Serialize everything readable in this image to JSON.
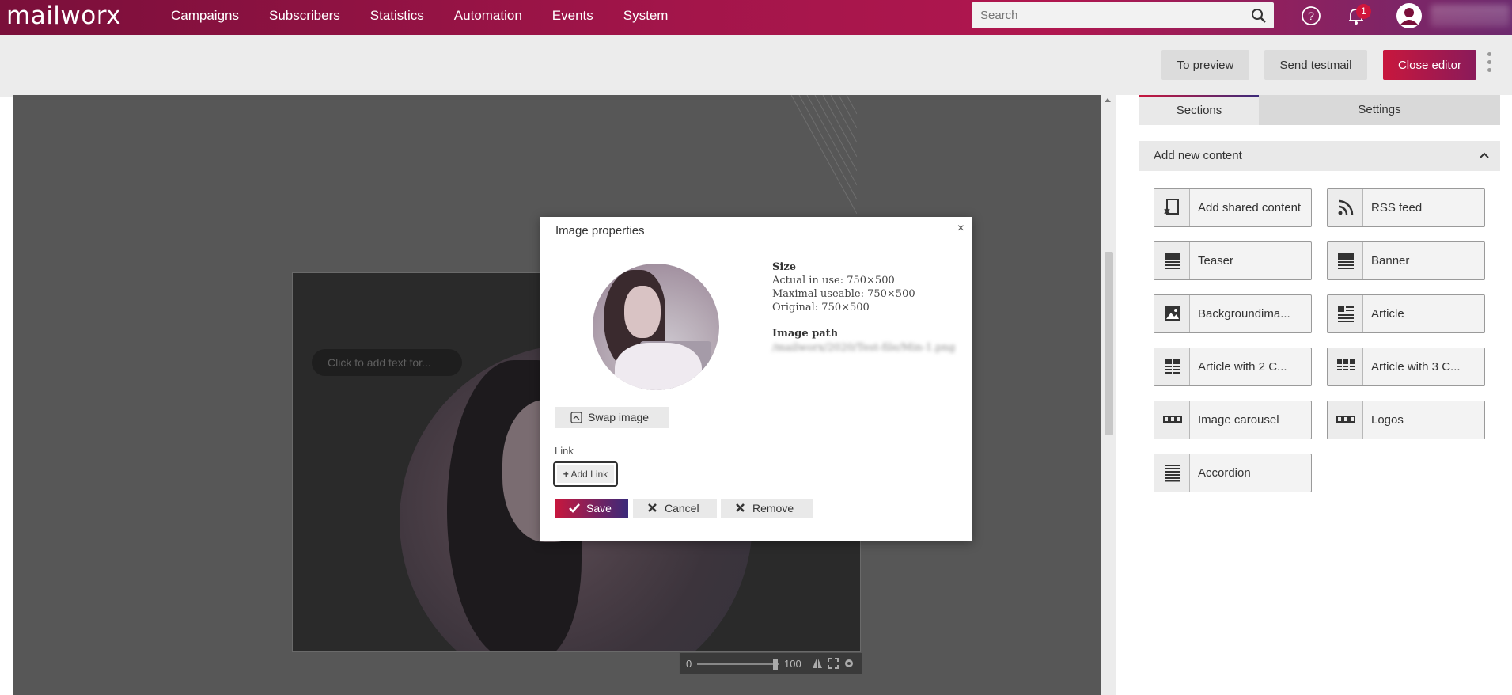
{
  "app": {
    "logo": "mailworx"
  },
  "nav": [
    {
      "label": "Campaigns",
      "active": true
    },
    {
      "label": "Subscribers"
    },
    {
      "label": "Statistics"
    },
    {
      "label": "Automation"
    },
    {
      "label": "Events"
    },
    {
      "label": "System"
    }
  ],
  "search": {
    "placeholder": "Search"
  },
  "notifications": {
    "count": "1"
  },
  "toolbar": {
    "preview": "To preview",
    "testmail": "Send testmail",
    "close": "Close editor"
  },
  "canvas": {
    "text_placeholder": "Click to add text for...",
    "zoom_min": "0",
    "zoom_max": "100"
  },
  "panel": {
    "tabs": [
      {
        "label": "Sections",
        "active": true
      },
      {
        "label": "Settings"
      }
    ],
    "section_title": "Add new content",
    "items": [
      {
        "label": "Add shared content",
        "icon": "shared-content-icon"
      },
      {
        "label": "RSS feed",
        "icon": "rss-icon"
      },
      {
        "label": "Teaser",
        "icon": "teaser-icon"
      },
      {
        "label": "Banner",
        "icon": "banner-icon"
      },
      {
        "label": "Backgroundima...",
        "icon": "background-image-icon"
      },
      {
        "label": "Article",
        "icon": "article-icon"
      },
      {
        "label": "Article with 2 C...",
        "icon": "article-2-columns-icon"
      },
      {
        "label": "Article with 3 C...",
        "icon": "article-3-columns-icon"
      },
      {
        "label": "Image carousel",
        "icon": "image-carousel-icon"
      },
      {
        "label": "Logos",
        "icon": "logos-icon"
      },
      {
        "label": "Accordion",
        "icon": "accordion-icon"
      }
    ]
  },
  "modal": {
    "title": "Image properties",
    "close": "×",
    "size_heading": "Size",
    "actual": "Actual in use: 750×500",
    "maximal": "Maximal useable: 750×500",
    "original": "Original: 750×500",
    "path_heading": "Image path",
    "path_value": "/mailworx/2020/Test-file/Min-1.png",
    "swap": "Swap image",
    "link_label": "Link",
    "add_link": "Add Link",
    "save": "Save",
    "cancel": "Cancel",
    "remove": "Remove"
  },
  "colors": {
    "brand": "#a3154a",
    "primary_button": "#c8173d"
  }
}
